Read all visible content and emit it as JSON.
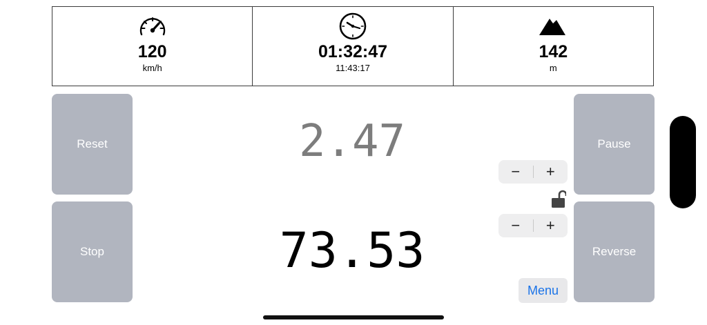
{
  "stats": [
    {
      "icon": "speedometer-icon",
      "value": "120",
      "sub": "km/h"
    },
    {
      "icon": "clock-icon",
      "value": "01:32:47",
      "sub": "11:43:17"
    },
    {
      "icon": "mountain-icon",
      "value": "142",
      "sub": "m"
    }
  ],
  "buttons": {
    "reset": "Reset",
    "stop": "Stop",
    "pause": "Pause",
    "reverse": "Reverse",
    "menu": "Menu"
  },
  "readouts": {
    "top": "2.47",
    "bottom": "73.53"
  },
  "steppers": {
    "minus": "−",
    "plus": "+"
  },
  "lock": {
    "state": "unlocked",
    "icon": "unlocked-padlock-icon"
  },
  "colors": {
    "button_bg": "#b1b5bf",
    "menu_text": "#1a73e8",
    "top_readout": "#7d7d7d"
  }
}
